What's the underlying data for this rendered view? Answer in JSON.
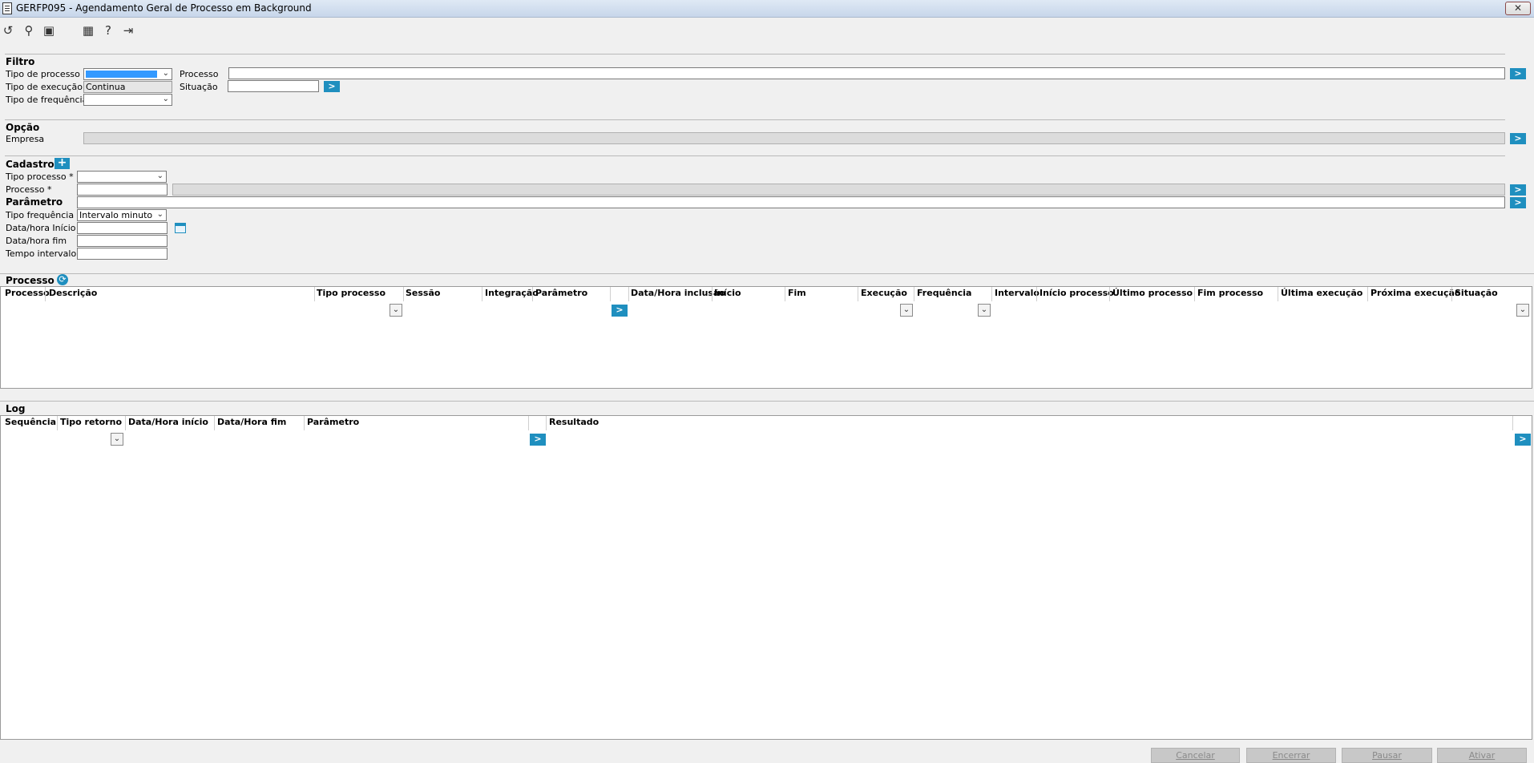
{
  "window": {
    "title": "GERFP095 - Agendamento Geral de Processo em Background",
    "close_label": "✕"
  },
  "toolbar": [
    {
      "name": "undo-icon",
      "glyph": "↺"
    },
    {
      "name": "search-icon",
      "glyph": "⚲"
    },
    {
      "name": "save-icon",
      "glyph": "▣"
    },
    {
      "name": "calendar-icon",
      "glyph": "▦"
    },
    {
      "name": "help-icon",
      "glyph": "?"
    },
    {
      "name": "exit-icon",
      "glyph": "⇥"
    }
  ],
  "filtro": {
    "title": "Filtro",
    "tipo_processo_label": "Tipo de processo",
    "tipo_execucao_label": "Tipo de execução",
    "tipo_execucao_option": "Continua",
    "tipo_frequencia_label": "Tipo de frequência",
    "processo_label": "Processo",
    "situacao_label": "Situação"
  },
  "opcao": {
    "title": "Opção",
    "empresa_label": "Empresa"
  },
  "cadastro": {
    "title": "Cadastro",
    "tipo_processo_label": "Tipo processo *",
    "processo_label": "Processo *",
    "parametro_label": "Parâmetro",
    "tipo_frequencia_label": "Tipo frequência *",
    "tipo_frequencia_value": "Intervalo minuto",
    "data_inicio_label": "Data/hora Início *",
    "data_fim_label": "Data/hora fim",
    "tempo_intervalo_label": "Tempo intervalo"
  },
  "processo_grid": {
    "title": "Processo",
    "columns": [
      "Processo",
      "Descrição",
      "Tipo processo",
      "Sessão",
      "Integração",
      "Parâmetro",
      "Data/Hora inclusão",
      "Início",
      "Fim",
      "Execução",
      "Frequência",
      "Intervalo",
      "Início processo",
      "Último processo",
      "Fim processo",
      "Última execução",
      "Próxima execução",
      "Situação"
    ]
  },
  "log_grid": {
    "title": "Log",
    "columns": [
      "Sequência",
      "Tipo retorno",
      "Data/Hora início",
      "Data/Hora fim",
      "Parâmetro",
      "Resultado"
    ]
  },
  "go_glyph": ">",
  "chevron_glyph": "⌄",
  "buttons": {
    "cancelar": "Cancelar",
    "encerrar": "Encerrar",
    "pausar": "Pausar",
    "ativar": "Ativar"
  }
}
